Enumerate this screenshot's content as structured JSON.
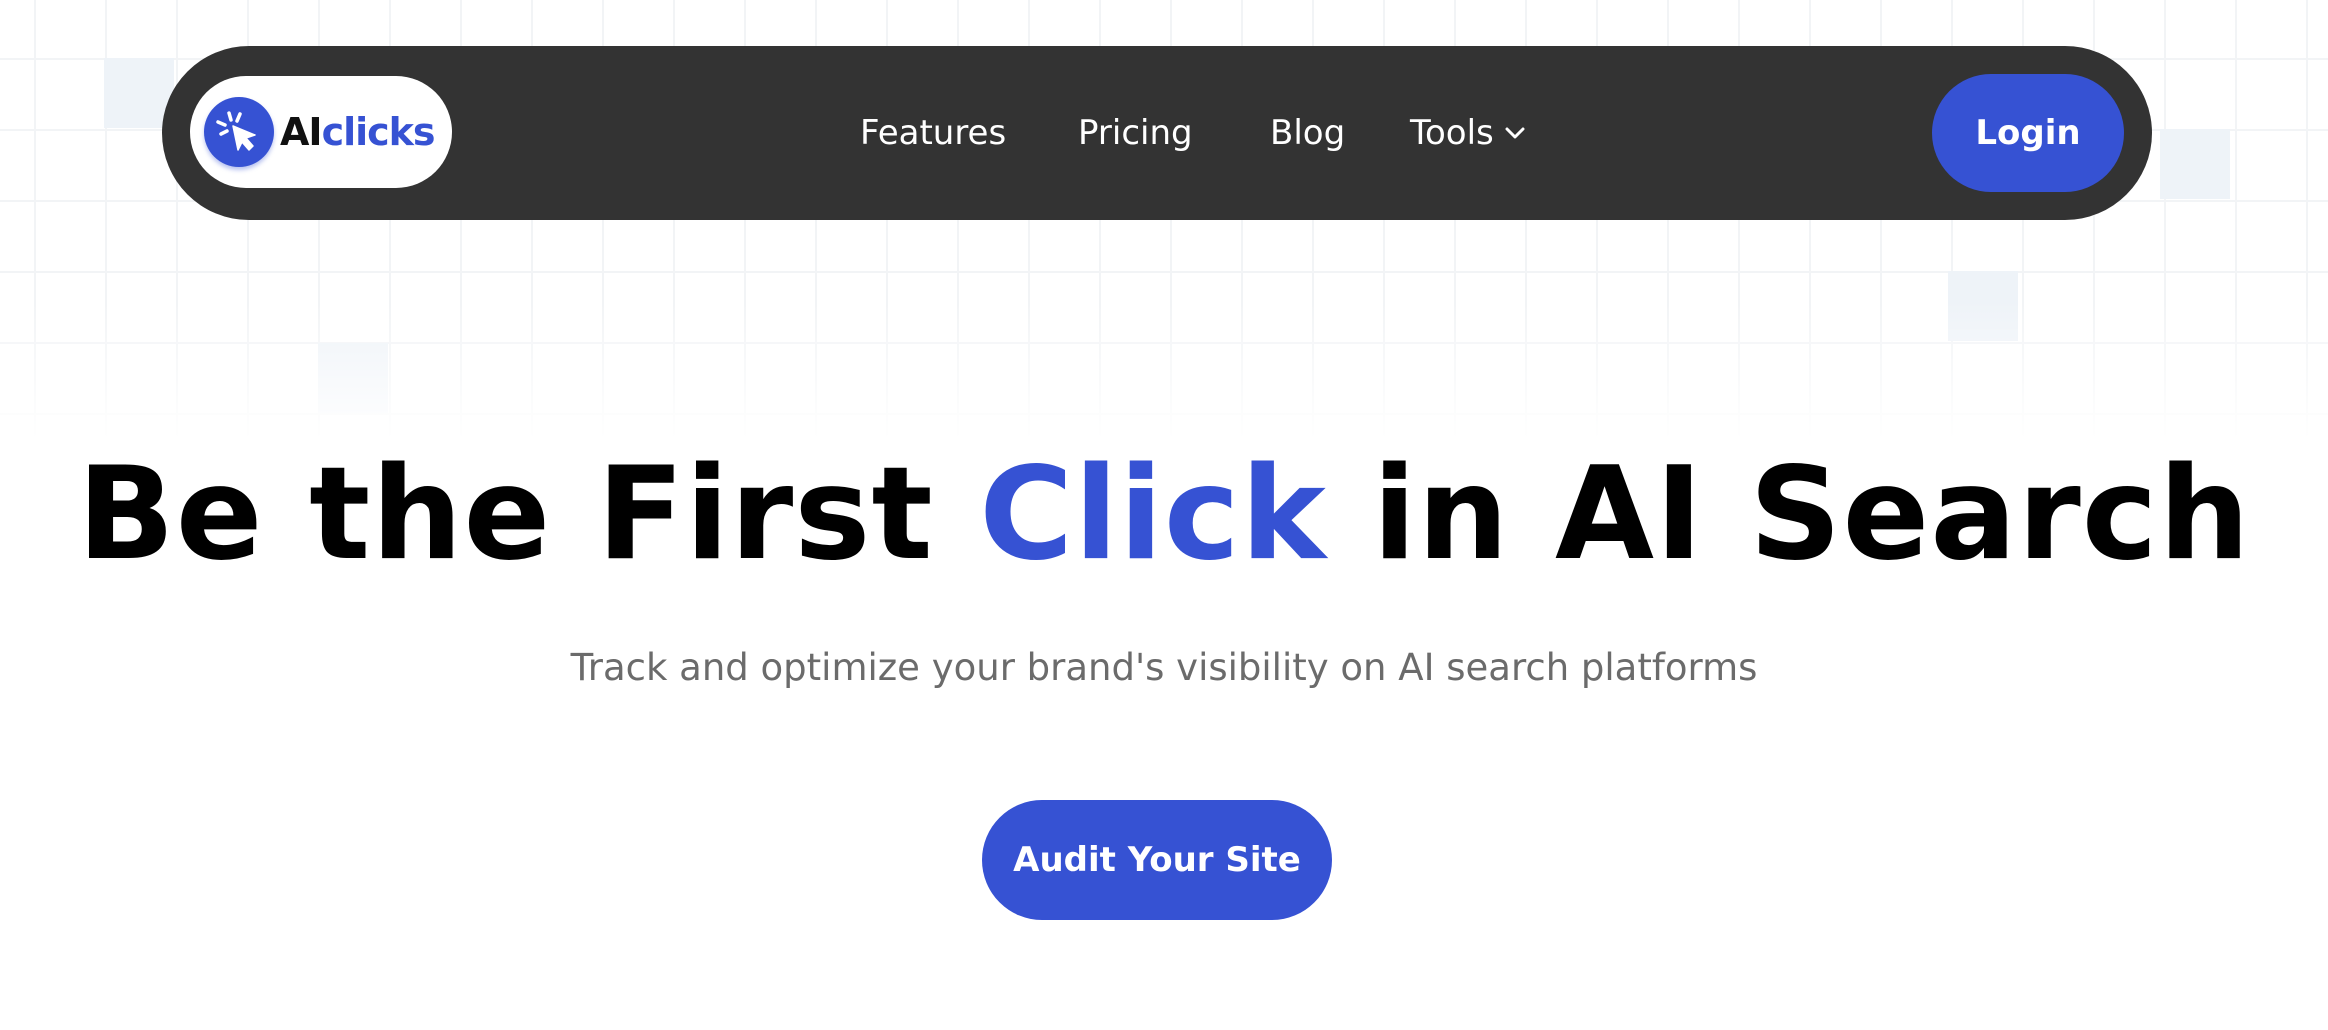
{
  "brand": {
    "name_part1": "AI",
    "name_part2": "clicks",
    "logo_icon": "cursor-click-icon",
    "accent_color": "#3652d3"
  },
  "nav": {
    "items": [
      {
        "label": "Features"
      },
      {
        "label": "Pricing"
      },
      {
        "label": "Blog"
      },
      {
        "label": "Tools",
        "icon": "chevron-down-icon"
      }
    ],
    "login_label": "Login"
  },
  "hero": {
    "title_before": "Be the First ",
    "title_accent": "Click",
    "title_after": " in AI Search",
    "subtitle": "Track and optimize your brand's visibility on AI search platforms",
    "cta_label": "Audit Your Site"
  },
  "colors": {
    "nav_background": "#333333",
    "primary": "#3652d3",
    "subtitle_text": "#6b6b6b"
  }
}
